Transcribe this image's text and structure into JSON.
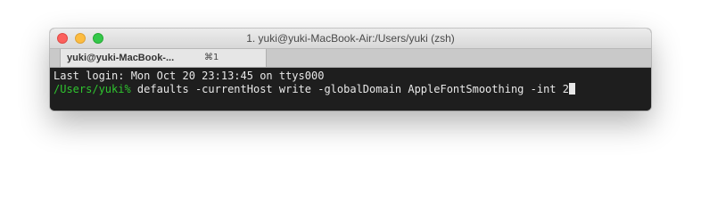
{
  "window": {
    "title": "1. yuki@yuki-MacBook-Air:/Users/yuki (zsh)"
  },
  "tabs": [
    {
      "label": "yuki@yuki-MacBook-...",
      "shortcut": "⌘1"
    }
  ],
  "terminal": {
    "last_login": "Last login: Mon Oct 20 23:13:45 on ttys000",
    "prompt": "/Users/yuki%",
    "command": " defaults -currentHost write -globalDomain AppleFontSmoothing -int 2"
  },
  "colors": {
    "prompt": "#2fc52f",
    "terminal_bg": "#1e1e1e",
    "close": "#fc605c",
    "minimize": "#fdbc40",
    "maximize": "#34c84a"
  }
}
